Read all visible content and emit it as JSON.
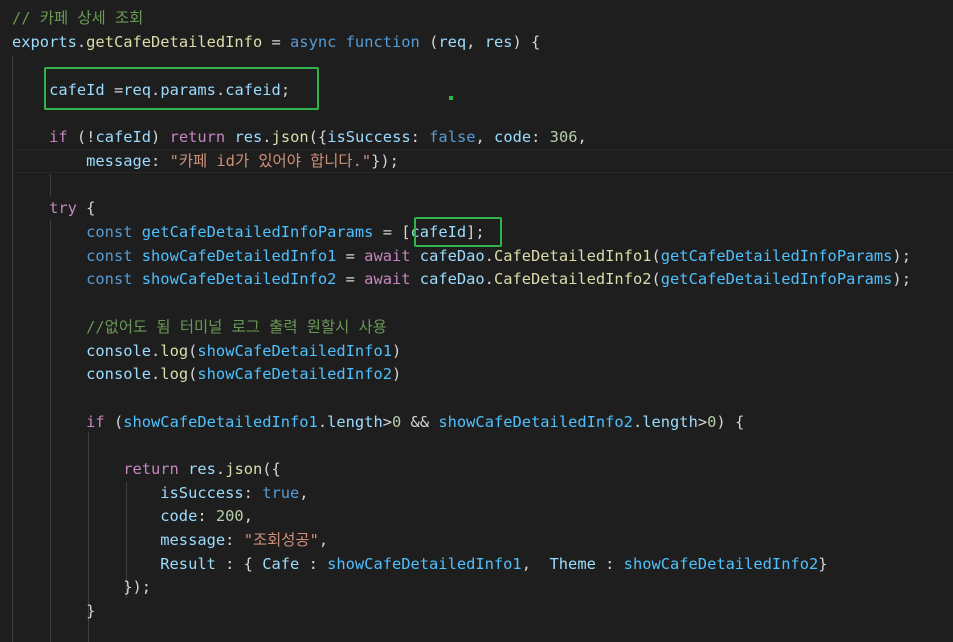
{
  "colors": {
    "background": "#1e1e1e",
    "comment": "#6a9955",
    "keyword": "#569cd6",
    "control": "#c586c0",
    "function": "#dcdcaa",
    "variable": "#9cdcfe",
    "text": "#d4d4d4",
    "string": "#ce9178",
    "number": "#b5cea8",
    "highlight_box": "#2fb34a"
  },
  "code_lines": [
    {
      "tokens": [
        [
          "cm",
          "// 카페 상세 조회"
        ]
      ]
    },
    {
      "tokens": [
        [
          "vr",
          "exports"
        ],
        [
          "tx",
          "."
        ],
        [
          "fn",
          "getCafeDetailedInfo"
        ],
        [
          "tx",
          " = "
        ],
        [
          "kw",
          "async"
        ],
        [
          "tx",
          " "
        ],
        [
          "kw",
          "function"
        ],
        [
          "tx",
          " ("
        ],
        [
          "vr",
          "req"
        ],
        [
          "tx",
          ", "
        ],
        [
          "vr",
          "res"
        ],
        [
          "tx",
          ") {"
        ]
      ]
    },
    {
      "tokens": []
    },
    {
      "tokens": [
        [
          "tx",
          "    "
        ],
        [
          "vr",
          "cafeId"
        ],
        [
          "tx",
          " ="
        ],
        [
          "vr",
          "req"
        ],
        [
          "tx",
          "."
        ],
        [
          "vr",
          "params"
        ],
        [
          "tx",
          "."
        ],
        [
          "vr",
          "cafeid"
        ],
        [
          "tx",
          ";"
        ]
      ]
    },
    {
      "tokens": []
    },
    {
      "tokens": [
        [
          "tx",
          "    "
        ],
        [
          "ctl",
          "if"
        ],
        [
          "tx",
          " (!"
        ],
        [
          "vr",
          "cafeId"
        ],
        [
          "tx",
          ") "
        ],
        [
          "ctl",
          "return"
        ],
        [
          "tx",
          " "
        ],
        [
          "vr",
          "res"
        ],
        [
          "tx",
          "."
        ],
        [
          "fn",
          "json"
        ],
        [
          "tx",
          "({"
        ],
        [
          "vr",
          "isSuccess"
        ],
        [
          "tx",
          ": "
        ],
        [
          "kw",
          "false"
        ],
        [
          "tx",
          ", "
        ],
        [
          "vr",
          "code"
        ],
        [
          "tx",
          ": "
        ],
        [
          "nm",
          "306"
        ],
        [
          "tx",
          ","
        ]
      ]
    },
    {
      "tokens": [
        [
          "tx",
          "        "
        ],
        [
          "vr",
          "message"
        ],
        [
          "tx",
          ": "
        ],
        [
          "st",
          "\"카페 id가 있어야 합니다.\""
        ],
        [
          "tx",
          "});"
        ]
      ]
    },
    {
      "tokens": []
    },
    {
      "tokens": [
        [
          "tx",
          "    "
        ],
        [
          "ctl",
          "try"
        ],
        [
          "tx",
          " {"
        ]
      ]
    },
    {
      "tokens": [
        [
          "tx",
          "        "
        ],
        [
          "kw",
          "const"
        ],
        [
          "tx",
          " "
        ],
        [
          "cn",
          "getCafeDetailedInfoParams"
        ],
        [
          "tx",
          " = "
        ],
        [
          "tx",
          "["
        ],
        [
          "vr",
          "cafeId"
        ],
        [
          "tx",
          "];"
        ]
      ]
    },
    {
      "tokens": [
        [
          "tx",
          "        "
        ],
        [
          "kw",
          "const"
        ],
        [
          "tx",
          " "
        ],
        [
          "cn",
          "showCafeDetailedInfo1"
        ],
        [
          "tx",
          " = "
        ],
        [
          "ctl",
          "await"
        ],
        [
          "tx",
          " "
        ],
        [
          "vr",
          "cafeDao"
        ],
        [
          "tx",
          "."
        ],
        [
          "fn",
          "CafeDetailedInfo1"
        ],
        [
          "tx",
          "("
        ],
        [
          "cn",
          "getCafeDetailedInfoParams"
        ],
        [
          "tx",
          ");"
        ]
      ]
    },
    {
      "tokens": [
        [
          "tx",
          "        "
        ],
        [
          "kw",
          "const"
        ],
        [
          "tx",
          " "
        ],
        [
          "cn",
          "showCafeDetailedInfo2"
        ],
        [
          "tx",
          " = "
        ],
        [
          "ctl",
          "await"
        ],
        [
          "tx",
          " "
        ],
        [
          "vr",
          "cafeDao"
        ],
        [
          "tx",
          "."
        ],
        [
          "fn",
          "CafeDetailedInfo2"
        ],
        [
          "tx",
          "("
        ],
        [
          "cn",
          "getCafeDetailedInfoParams"
        ],
        [
          "tx",
          ");"
        ]
      ]
    },
    {
      "tokens": []
    },
    {
      "tokens": [
        [
          "tx",
          "        "
        ],
        [
          "cm",
          "//없어도 됨 터미널 로그 출력 원할시 사용"
        ]
      ]
    },
    {
      "tokens": [
        [
          "tx",
          "        "
        ],
        [
          "vr",
          "console"
        ],
        [
          "tx",
          "."
        ],
        [
          "fn",
          "log"
        ],
        [
          "tx",
          "("
        ],
        [
          "cn",
          "showCafeDetailedInfo1"
        ],
        [
          "tx",
          ")"
        ]
      ]
    },
    {
      "tokens": [
        [
          "tx",
          "        "
        ],
        [
          "vr",
          "console"
        ],
        [
          "tx",
          "."
        ],
        [
          "fn",
          "log"
        ],
        [
          "tx",
          "("
        ],
        [
          "cn",
          "showCafeDetailedInfo2"
        ],
        [
          "tx",
          ")"
        ]
      ]
    },
    {
      "tokens": []
    },
    {
      "tokens": [
        [
          "tx",
          "        "
        ],
        [
          "ctl",
          "if"
        ],
        [
          "tx",
          " ("
        ],
        [
          "cn",
          "showCafeDetailedInfo1"
        ],
        [
          "tx",
          "."
        ],
        [
          "vr",
          "length"
        ],
        [
          "tx",
          ">"
        ],
        [
          "nm",
          "0"
        ],
        [
          "tx",
          " && "
        ],
        [
          "cn",
          "showCafeDetailedInfo2"
        ],
        [
          "tx",
          "."
        ],
        [
          "vr",
          "length"
        ],
        [
          "tx",
          ">"
        ],
        [
          "nm",
          "0"
        ],
        [
          "tx",
          ") {"
        ]
      ]
    },
    {
      "tokens": []
    },
    {
      "tokens": [
        [
          "tx",
          "            "
        ],
        [
          "ctl",
          "return"
        ],
        [
          "tx",
          " "
        ],
        [
          "vr",
          "res"
        ],
        [
          "tx",
          "."
        ],
        [
          "fn",
          "json"
        ],
        [
          "tx",
          "({"
        ]
      ]
    },
    {
      "tokens": [
        [
          "tx",
          "                "
        ],
        [
          "vr",
          "isSuccess"
        ],
        [
          "tx",
          ": "
        ],
        [
          "kw",
          "true"
        ],
        [
          "tx",
          ","
        ]
      ]
    },
    {
      "tokens": [
        [
          "tx",
          "                "
        ],
        [
          "vr",
          "code"
        ],
        [
          "tx",
          ": "
        ],
        [
          "nm",
          "200"
        ],
        [
          "tx",
          ","
        ]
      ]
    },
    {
      "tokens": [
        [
          "tx",
          "                "
        ],
        [
          "vr",
          "message"
        ],
        [
          "tx",
          ": "
        ],
        [
          "st",
          "\"조회성공\""
        ],
        [
          "tx",
          ","
        ]
      ]
    },
    {
      "tokens": [
        [
          "tx",
          "                "
        ],
        [
          "vr",
          "Result"
        ],
        [
          "tx",
          " : { "
        ],
        [
          "vr",
          "Cafe"
        ],
        [
          "tx",
          " : "
        ],
        [
          "cn",
          "showCafeDetailedInfo1"
        ],
        [
          "tx",
          ",  "
        ],
        [
          "vr",
          "Theme"
        ],
        [
          "tx",
          " : "
        ],
        [
          "cn",
          "showCafeDetailedInfo2"
        ],
        [
          "tx",
          "}"
        ]
      ]
    },
    {
      "tokens": [
        [
          "tx",
          "            "
        ],
        [
          "tx",
          "});"
        ]
      ]
    },
    {
      "tokens": [
        [
          "tx",
          "        "
        ],
        [
          "tx",
          "}"
        ]
      ]
    }
  ]
}
